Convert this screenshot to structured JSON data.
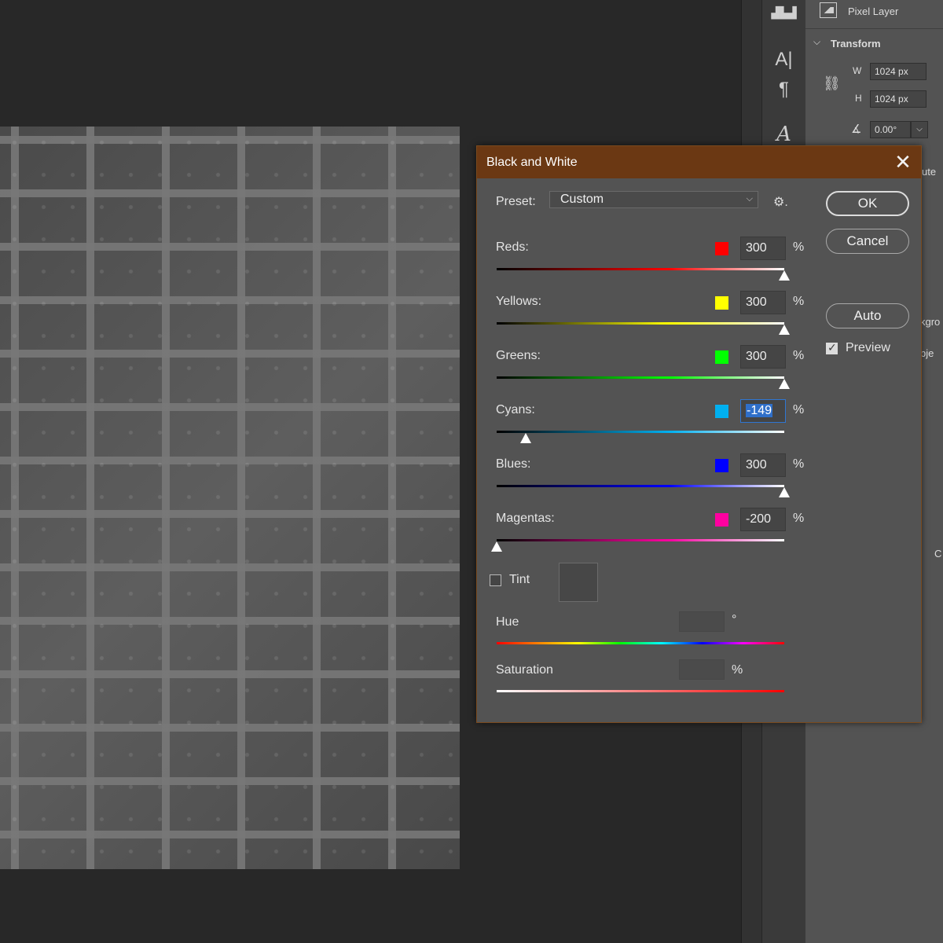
{
  "right_panel": {
    "layer_kind": "Pixel Layer",
    "section_title": "Transform",
    "w_label": "W",
    "w_value": "1024 px",
    "h_label": "H",
    "h_value": "1024 px",
    "angle_value": "0.00°",
    "cut_texts": [
      "ute",
      "kgro",
      "bje",
      "C"
    ]
  },
  "dialog": {
    "title": "Black and White",
    "close_glyph": "✕",
    "preset_label": "Preset:",
    "preset_value": "Custom",
    "buttons": {
      "ok": "OK",
      "cancel": "Cancel",
      "auto": "Auto"
    },
    "preview": {
      "label": "Preview",
      "checked": true
    },
    "channels": [
      {
        "label": "Reds:",
        "value": "300",
        "unit": "%",
        "color": "#ff0000",
        "slider_fraction": 1.0
      },
      {
        "label": "Yellows:",
        "value": "300",
        "unit": "%",
        "color": "#ffff00",
        "slider_fraction": 1.0
      },
      {
        "label": "Greens:",
        "value": "300",
        "unit": "%",
        "color": "#00ff00",
        "slider_fraction": 1.0
      },
      {
        "label": "Cyans:",
        "value": "-149",
        "unit": "%",
        "color": "#00b0f0",
        "slider_fraction": 0.1,
        "active": true
      },
      {
        "label": "Blues:",
        "value": "300",
        "unit": "%",
        "color": "#0000ff",
        "slider_fraction": 1.0
      },
      {
        "label": "Magentas:",
        "value": "-200",
        "unit": "%",
        "color": "#ff00a0",
        "slider_fraction": 0.0
      }
    ],
    "tint": {
      "label": "Tint",
      "checked": false
    },
    "hue": {
      "label": "Hue",
      "unit": "°"
    },
    "saturation": {
      "label": "Saturation",
      "unit": "%"
    }
  }
}
